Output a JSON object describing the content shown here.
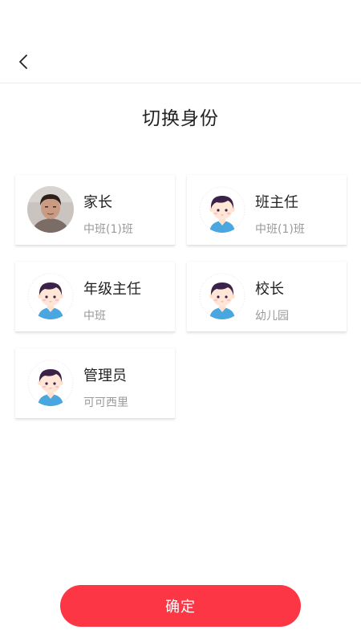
{
  "header": {
    "back_icon": "chevron-left-icon"
  },
  "page": {
    "title": "切换身份"
  },
  "identities": [
    {
      "role": "家长",
      "org": "中班(1)班",
      "avatar": "photo-avatar"
    },
    {
      "role": "班主任",
      "org": "中班(1)班",
      "avatar": "cartoon-boy-avatar"
    },
    {
      "role": "年级主任",
      "org": "中班",
      "avatar": "cartoon-boy-avatar"
    },
    {
      "role": "校长",
      "org": "幼儿园",
      "avatar": "cartoon-boy-avatar"
    },
    {
      "role": "管理员",
      "org": "可可西里",
      "avatar": "cartoon-boy-avatar"
    }
  ],
  "footer": {
    "confirm_label": "确定"
  },
  "colors": {
    "accent": "#fd3645",
    "subtext": "#9a9a9a",
    "divider": "#ececec"
  }
}
